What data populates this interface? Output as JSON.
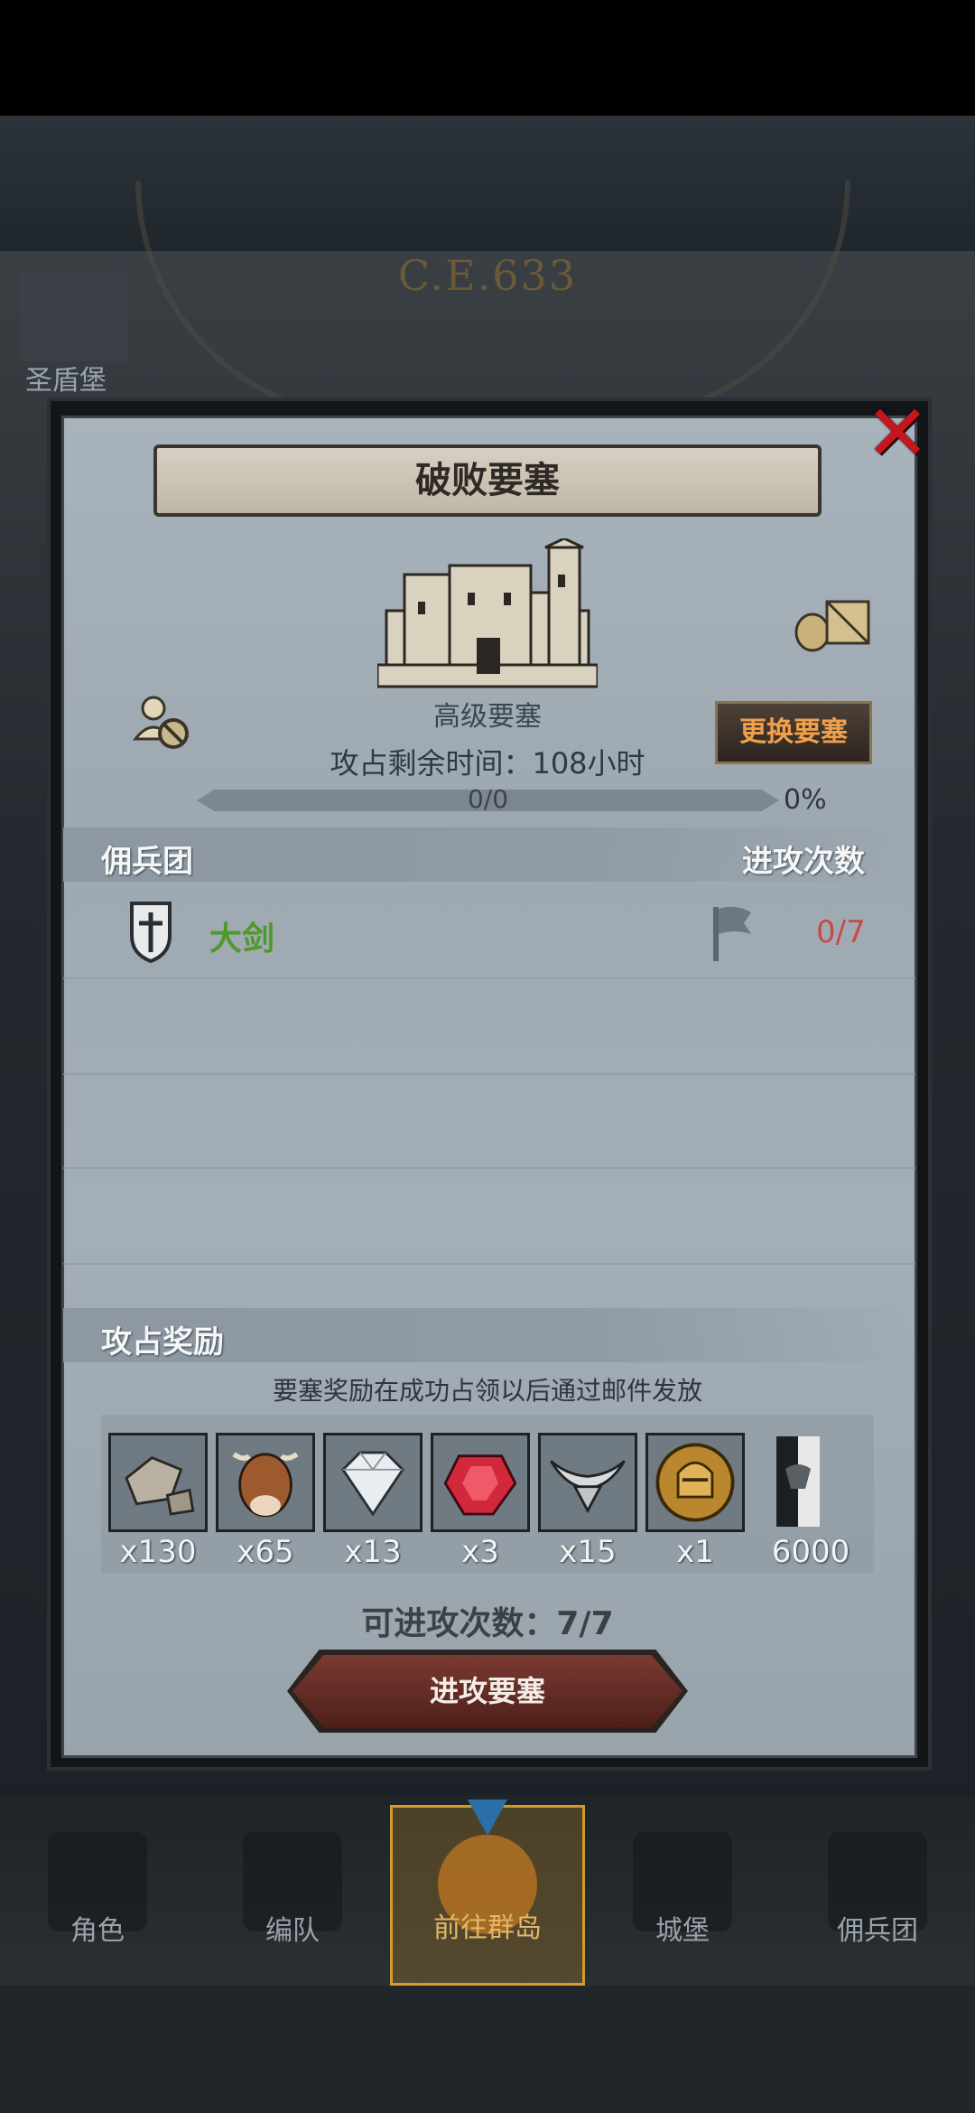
{
  "background": {
    "era": "C.E.633",
    "castle_label": "圣盾堡"
  },
  "dialog": {
    "title": "破败要塞",
    "fortress_level": "高级要塞",
    "remaining_time": "攻占剩余时间：108小时",
    "change_button": "更换要塞",
    "progress": {
      "value_text": "0/0",
      "percent_text": "0%",
      "fill": 0.0
    },
    "mercenary_header": "佣兵团",
    "attack_count_header": "进攻次数",
    "mercenaries": [
      {
        "name": "大剑",
        "count": "0/7"
      }
    ],
    "rewards_header": "攻占奖励",
    "rewards_note": "要塞奖励在成功占领以后通过邮件发放",
    "rewards": [
      {
        "icon": "stone-icon",
        "count": "x130"
      },
      {
        "icon": "ox-icon",
        "count": "x65"
      },
      {
        "icon": "diamond-icon",
        "count": "x13"
      },
      {
        "icon": "ruby-icon",
        "count": "x3"
      },
      {
        "icon": "horns-icon",
        "count": "x15"
      },
      {
        "icon": "knight-coin-icon",
        "count": "x1"
      },
      {
        "icon": "banner-icon",
        "count": "6000"
      }
    ],
    "attacks_left": "可进攻次数：7/7",
    "attack_button": "进攻要塞"
  },
  "nav": {
    "items": [
      {
        "label": "角色"
      },
      {
        "label": "编队"
      },
      {
        "label": "前往群岛",
        "active": true
      },
      {
        "label": "城堡"
      },
      {
        "label": "佣兵团"
      }
    ]
  },
  "colors": {
    "accent_gold": "#d59a2a",
    "merc_name_green": "#4f9a2b",
    "count_red": "#c84a48",
    "close_red": "#c4161c"
  }
}
